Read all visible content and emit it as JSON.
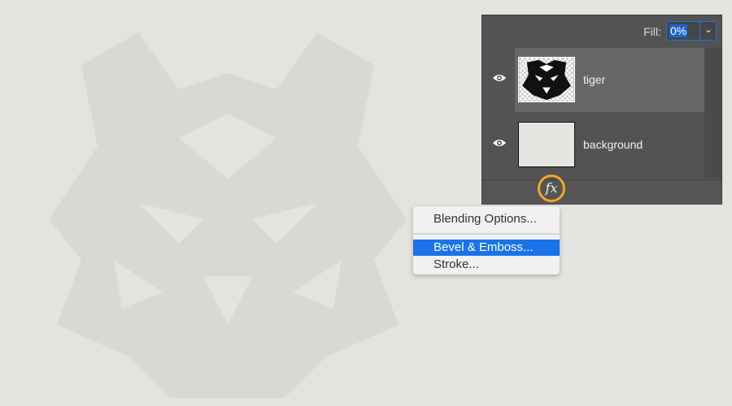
{
  "panel": {
    "fill_label": "Fill:",
    "fill_value": "0%",
    "layers": [
      {
        "name": "tiger",
        "visible": true,
        "selected": true,
        "icon": "eye-icon"
      },
      {
        "name": "background",
        "visible": true,
        "selected": false,
        "icon": "eye-icon"
      }
    ],
    "fx_label": "fx"
  },
  "menu": {
    "items": [
      {
        "label": "Blending Options..."
      },
      {
        "label": "Bevel & Emboss...",
        "highlighted": true
      },
      {
        "label": "Stroke..."
      }
    ]
  },
  "colors": {
    "accent": "#1a73e8",
    "highlight_ring": "#f5a623",
    "panel": "#535353"
  }
}
